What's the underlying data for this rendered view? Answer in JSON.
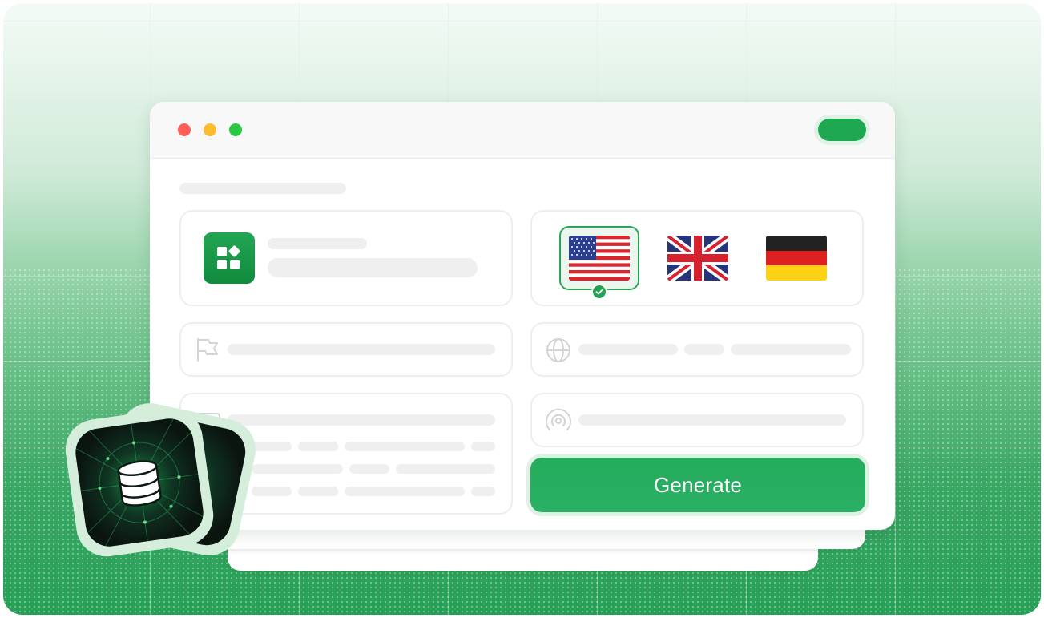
{
  "generate_button": {
    "label": "Generate"
  },
  "window": {
    "traffic_lights": [
      "#ff5f57",
      "#ffbd2e",
      "#28c840"
    ],
    "action_pill_color": "#1ea852"
  },
  "languages": [
    {
      "name": "united-states-flag",
      "selected": true
    },
    {
      "name": "united-kingdom-flag",
      "selected": false
    },
    {
      "name": "germany-flag",
      "selected": false
    }
  ],
  "icons": {
    "app": "app-grid-icon",
    "flag": "flag-icon",
    "globe": "globe-icon",
    "keyboard": "keyboard-icon",
    "signal": "broadcast-icon",
    "database": "database-icon"
  },
  "colors": {
    "accent": "#1ea852",
    "selected_border": "#2aa55a"
  }
}
